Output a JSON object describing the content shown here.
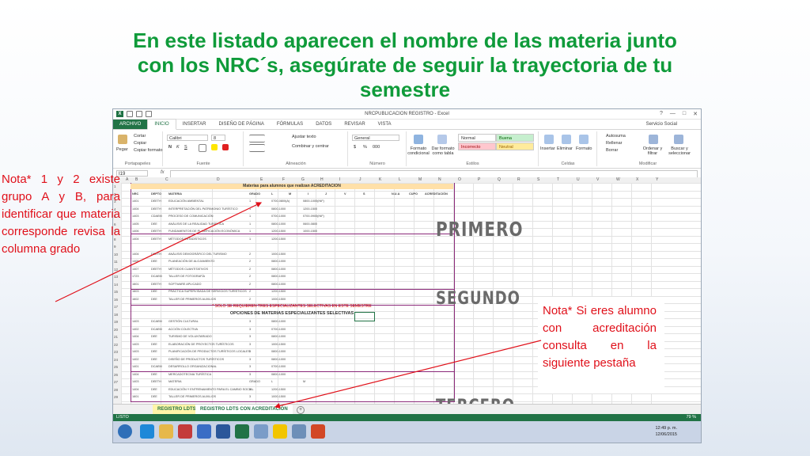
{
  "slide": {
    "title_line1": "En este listado aparecen el nombre de las materia junto",
    "title_line2": "con los NRC´s, asegúrate de seguir la trayectoria de tu",
    "title_line3": "semestre",
    "note_left": "Nota* 1 y 2 existe grupo A y B, para identificar que materia corresponde revisa la columna grado",
    "note_right": "Nota* Si eres alumno con acreditación consulta en la siguiente pestaña"
  },
  "excel": {
    "window_title": "NRCPUBLICACION REGISTRO - Excel",
    "logo": "X",
    "window_controls": [
      "?",
      "—",
      "□",
      "✕"
    ],
    "tabs": [
      "ARCHIVO",
      "INICIO",
      "INSERTAR",
      "DISEÑO DE PÁGINA",
      "FÓRMULAS",
      "DATOS",
      "REVISAR",
      "VISTA"
    ],
    "user": "Servicio Social",
    "ribbon": {
      "paste": "Pegar",
      "cut": "Cortar",
      "copy": "Copiar",
      "format_painter": "Copiar formato",
      "font_name": "Calibri",
      "font_size": "8",
      "bold": "N",
      "italic": "K",
      "underline": "S",
      "wrap_text": "Ajustar texto",
      "merge_center": "Combinar y centrar",
      "number_format": "General",
      "currency": "$",
      "percent": "%",
      "thousands": "000",
      "conditional_format": "Formato condicional",
      "format_as_table": "Dar formato como tabla",
      "styles": [
        "Normal",
        "Buena",
        "Incorrecto",
        "Neutral"
      ],
      "insert": "Insertar",
      "delete": "Eliminar",
      "format": "Formato",
      "autosum": "Autosuma",
      "fill": "Rellenar",
      "clear": "Borrar",
      "sort_filter": "Ordenar y filtrar",
      "find_select": "Buscar y seleccionar",
      "groups": [
        "Portapapeles",
        "Fuente",
        "Alineación",
        "Número",
        "Estilos",
        "Celdas",
        "Modificar"
      ]
    },
    "name_box": "I19",
    "fx": "fx",
    "columns": [
      "A",
      "B",
      "C",
      "D",
      "E",
      "F",
      "G",
      "H",
      "I",
      "J",
      "K",
      "L",
      "M",
      "N",
      "O",
      "P",
      "Q",
      "R",
      "S",
      "T",
      "U",
      "V",
      "W",
      "X",
      "Y"
    ],
    "rows": [
      "1",
      "2",
      "3",
      "4",
      "5",
      "6",
      "7",
      "8",
      "9",
      "10",
      "11",
      "12",
      "13",
      "14",
      "15",
      "16",
      "17",
      "18",
      "19",
      "20",
      "21",
      "22",
      "23",
      "24",
      "25",
      "26",
      "27",
      "28",
      "29"
    ],
    "sheet_title": "Materias para alumnos que realizan ACREDITACION",
    "header_row": [
      "NRC",
      "DEPTO",
      "MATERIA",
      "GRADO",
      "L",
      "M",
      "I",
      "J",
      "V",
      "S",
      "N.U.A",
      "CUPO",
      "ACREDITACIÓN"
    ],
    "section_note": "* SOLO SE REQUIEREN TRES ESPECIALIZANTES SELECTIVAS EN ESTE SEMESTRE",
    "options_title": "OPCIONES DE MATERIAS ESPECIALIZANTES SELECTIVAS",
    "data_rows": [
      [
        "1401",
        "DEETH",
        "EDUCACIÓN AMBIENTAL",
        "1",
        "0700-0800(A)",
        "0800-1000(INF)"
      ],
      [
        "1404",
        "DEETH",
        "INTERPRETACIÓN DEL PATRIMONIO TURÍSTICO",
        "1",
        "0800-1000",
        "1200-1500"
      ],
      [
        "1403",
        "CDAEM",
        "PROCESO DE COMUNICACIÓN",
        "1",
        "0700-1000",
        "0700-0900(INF)"
      ],
      [
        "1405",
        "DEE",
        "ANÁLISIS DE LA REALIDAD TURÍSTICA",
        "1",
        "0800-1000",
        "0600-0800"
      ],
      [
        "1406",
        "DEETH",
        "FUNDAMENTOS DE PLANIFICACIÓN ECONÓMICA",
        "1",
        "1200-1500",
        "1000-1500"
      ],
      [
        "1404",
        "DEETH",
        "MÉTODOS ESTADÍSTICOS",
        "1",
        "1200-1500"
      ],
      [
        "1404",
        "DEETH",
        "ANÁLISIS DEMOGRÁFICO DEL TURISMO",
        "2",
        "1000-1500"
      ],
      [
        "1405",
        "DEE",
        "PLANEACIÓN DE ALOJAMIENTO",
        "2",
        "0800-1000"
      ],
      [
        "1407",
        "DEETH",
        "MÉTODOS CUANTITATIVOS",
        "2",
        "0800-1000"
      ],
      [
        "1723",
        "DCAEM",
        "TALLER DE FOTOGRAFÍA",
        "2",
        "0800-1000"
      ],
      [
        "1601",
        "DEETH",
        "SOFTWARE APLICADO",
        "2",
        "0800-1000"
      ],
      [
        "1603",
        "DEE",
        "PRÁCTICA SUPERVISADA DE SERVICIOS TURÍSTICOS",
        "2",
        "1200-1500"
      ],
      [
        "1602",
        "DEE",
        "TALLER DE PRIMEROS AUXILIOS",
        "2",
        "1000-1500"
      ],
      [
        "1403",
        "DCAEM",
        "GESTIÓN CULTURAL",
        "3",
        "0800-1000"
      ],
      [
        "1402",
        "DCAEM",
        "ACCIÓN COLECTIVA",
        "3",
        "0700-1000"
      ],
      [
        "1404",
        "DEE",
        "TURISMO DE VOLUNTARIADO",
        "3",
        "0800-1000"
      ],
      [
        "1403",
        "DEE",
        "ELABORACIÓN DE PROYECTOS TURÍSTICOS",
        "3",
        "1000-1500"
      ],
      [
        "1403",
        "DEE",
        "PLANIFICACIÓN DE PRODUCTOS TURÍSTICOS LOCALES",
        "3",
        "0800-1000"
      ],
      [
        "1402",
        "DEE",
        "DISEÑO DE PRODUCTOS TURÍSTICOS",
        "3",
        "0800-1000"
      ],
      [
        "1401",
        "DCAEM",
        "DESARROLLO ORGANIZACIONAL",
        "3",
        "0700-1000"
      ],
      [
        "1404",
        "DEE",
        "MERCADOTECNIA TURÍSTICA",
        "3",
        "0800-1000"
      ],
      [
        "1403",
        "DEETH",
        "MATERIA",
        "GRADO",
        "L",
        "M"
      ],
      [
        "1404",
        "DEE",
        "EDUCACIÓN Y ENTRENAMIENTO PARA EL CAMBIO SOCIAL",
        "3",
        "1200-1500"
      ],
      [
        "1601",
        "DEE",
        "TALLER DE PRIMEROS AUXILIOS",
        "3",
        "1000-1500"
      ]
    ],
    "semester_labels": [
      "PRIMERO",
      "SEGUNDO",
      "TERCERO"
    ],
    "sheet_tabs": [
      "REGISTRO LDTS",
      "REGISTRO LDTS CON ACREDITACIÓN"
    ],
    "add_sheet": "+",
    "status_left": "LISTO",
    "status_zoom": "79 %",
    "clock_time": "12:49 p. m.",
    "clock_date": "12/06/2015"
  },
  "colors": {
    "title_green": "#0f9b3a",
    "note_red": "#e0101a",
    "excel_green": "#217346",
    "table_border": "#8b2a7a"
  }
}
